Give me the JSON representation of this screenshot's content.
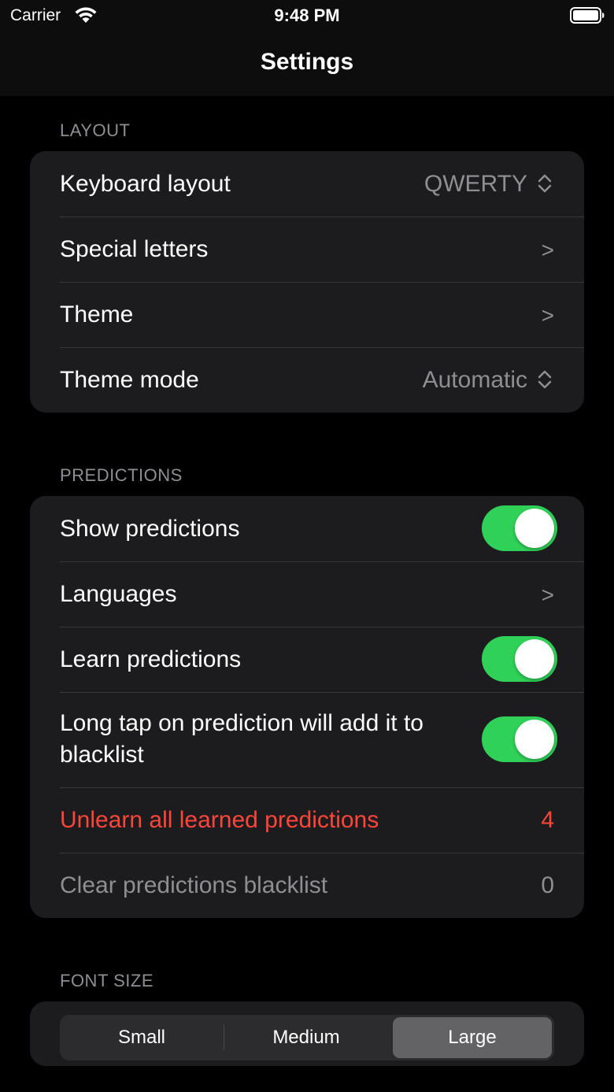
{
  "status_bar": {
    "carrier": "Carrier",
    "time": "9:48 PM"
  },
  "nav": {
    "title": "Settings"
  },
  "layout_section": {
    "header": "LAYOUT",
    "keyboard_layout": {
      "label": "Keyboard layout",
      "value": "QWERTY"
    },
    "special_letters": {
      "label": "Special letters",
      "chevron": ">"
    },
    "theme": {
      "label": "Theme",
      "chevron": ">"
    },
    "theme_mode": {
      "label": "Theme mode",
      "value": "Automatic"
    }
  },
  "predictions_section": {
    "header": "PREDICTIONS",
    "show_predictions": {
      "label": "Show predictions",
      "on": true
    },
    "languages": {
      "label": "Languages",
      "chevron": ">"
    },
    "learn_predictions": {
      "label": "Learn predictions",
      "on": true
    },
    "long_tap_blacklist": {
      "label": "Long tap on prediction will add it to blacklist",
      "on": true
    },
    "unlearn_all": {
      "label": "Unlearn all learned predictions",
      "count": "4"
    },
    "clear_blacklist": {
      "label": "Clear predictions blacklist",
      "count": "0"
    }
  },
  "font_size_section": {
    "header": "FONT SIZE",
    "options": [
      "Small",
      "Medium",
      "Large"
    ],
    "selected": "Large"
  },
  "colors": {
    "background": "#000000",
    "group_background": "#1c1c1e",
    "toggle_on": "#30d158",
    "destructive": "#ff453a",
    "secondary_text": "#8e8e93"
  },
  "icons": [
    "wifi-icon",
    "battery-icon",
    "up-down-chevron-icon",
    "chevron-right-icon"
  ]
}
